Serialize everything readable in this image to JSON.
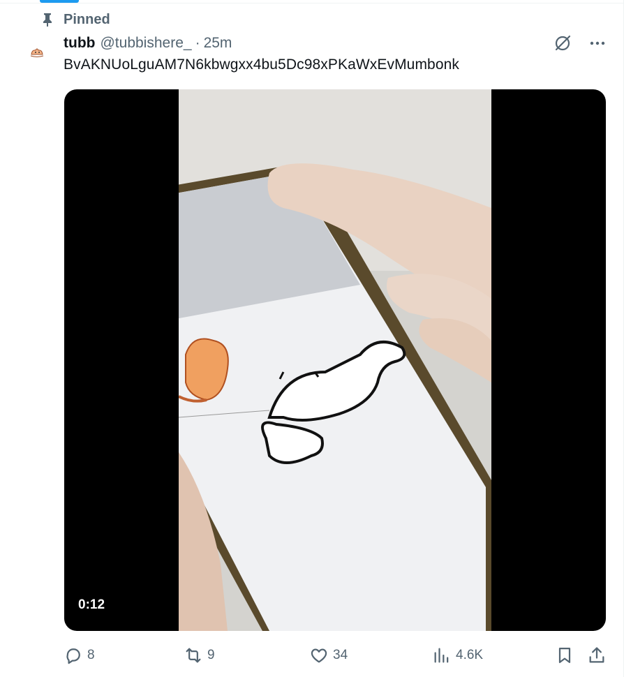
{
  "pinned": {
    "label": "Pinned",
    "icon": "pin-icon"
  },
  "tweet": {
    "display_name": "tubb",
    "handle": "@tubbishere_",
    "separator": "·",
    "timestamp": "25m",
    "text": "BvAKNUoLguAM7N6kbwgxx4bu5Dc98xPKaWxEvMumbonk",
    "media": {
      "type": "video",
      "duration": "0:12"
    }
  },
  "header_actions": {
    "grok_icon": "grok-icon",
    "more_icon": "more-icon"
  },
  "actions": {
    "replies": "8",
    "reposts": "9",
    "likes": "34",
    "views": "4.6K"
  },
  "colors": {
    "accent": "#1d9bf0",
    "secondary_text": "#536471",
    "primary_text": "#0f1419"
  }
}
